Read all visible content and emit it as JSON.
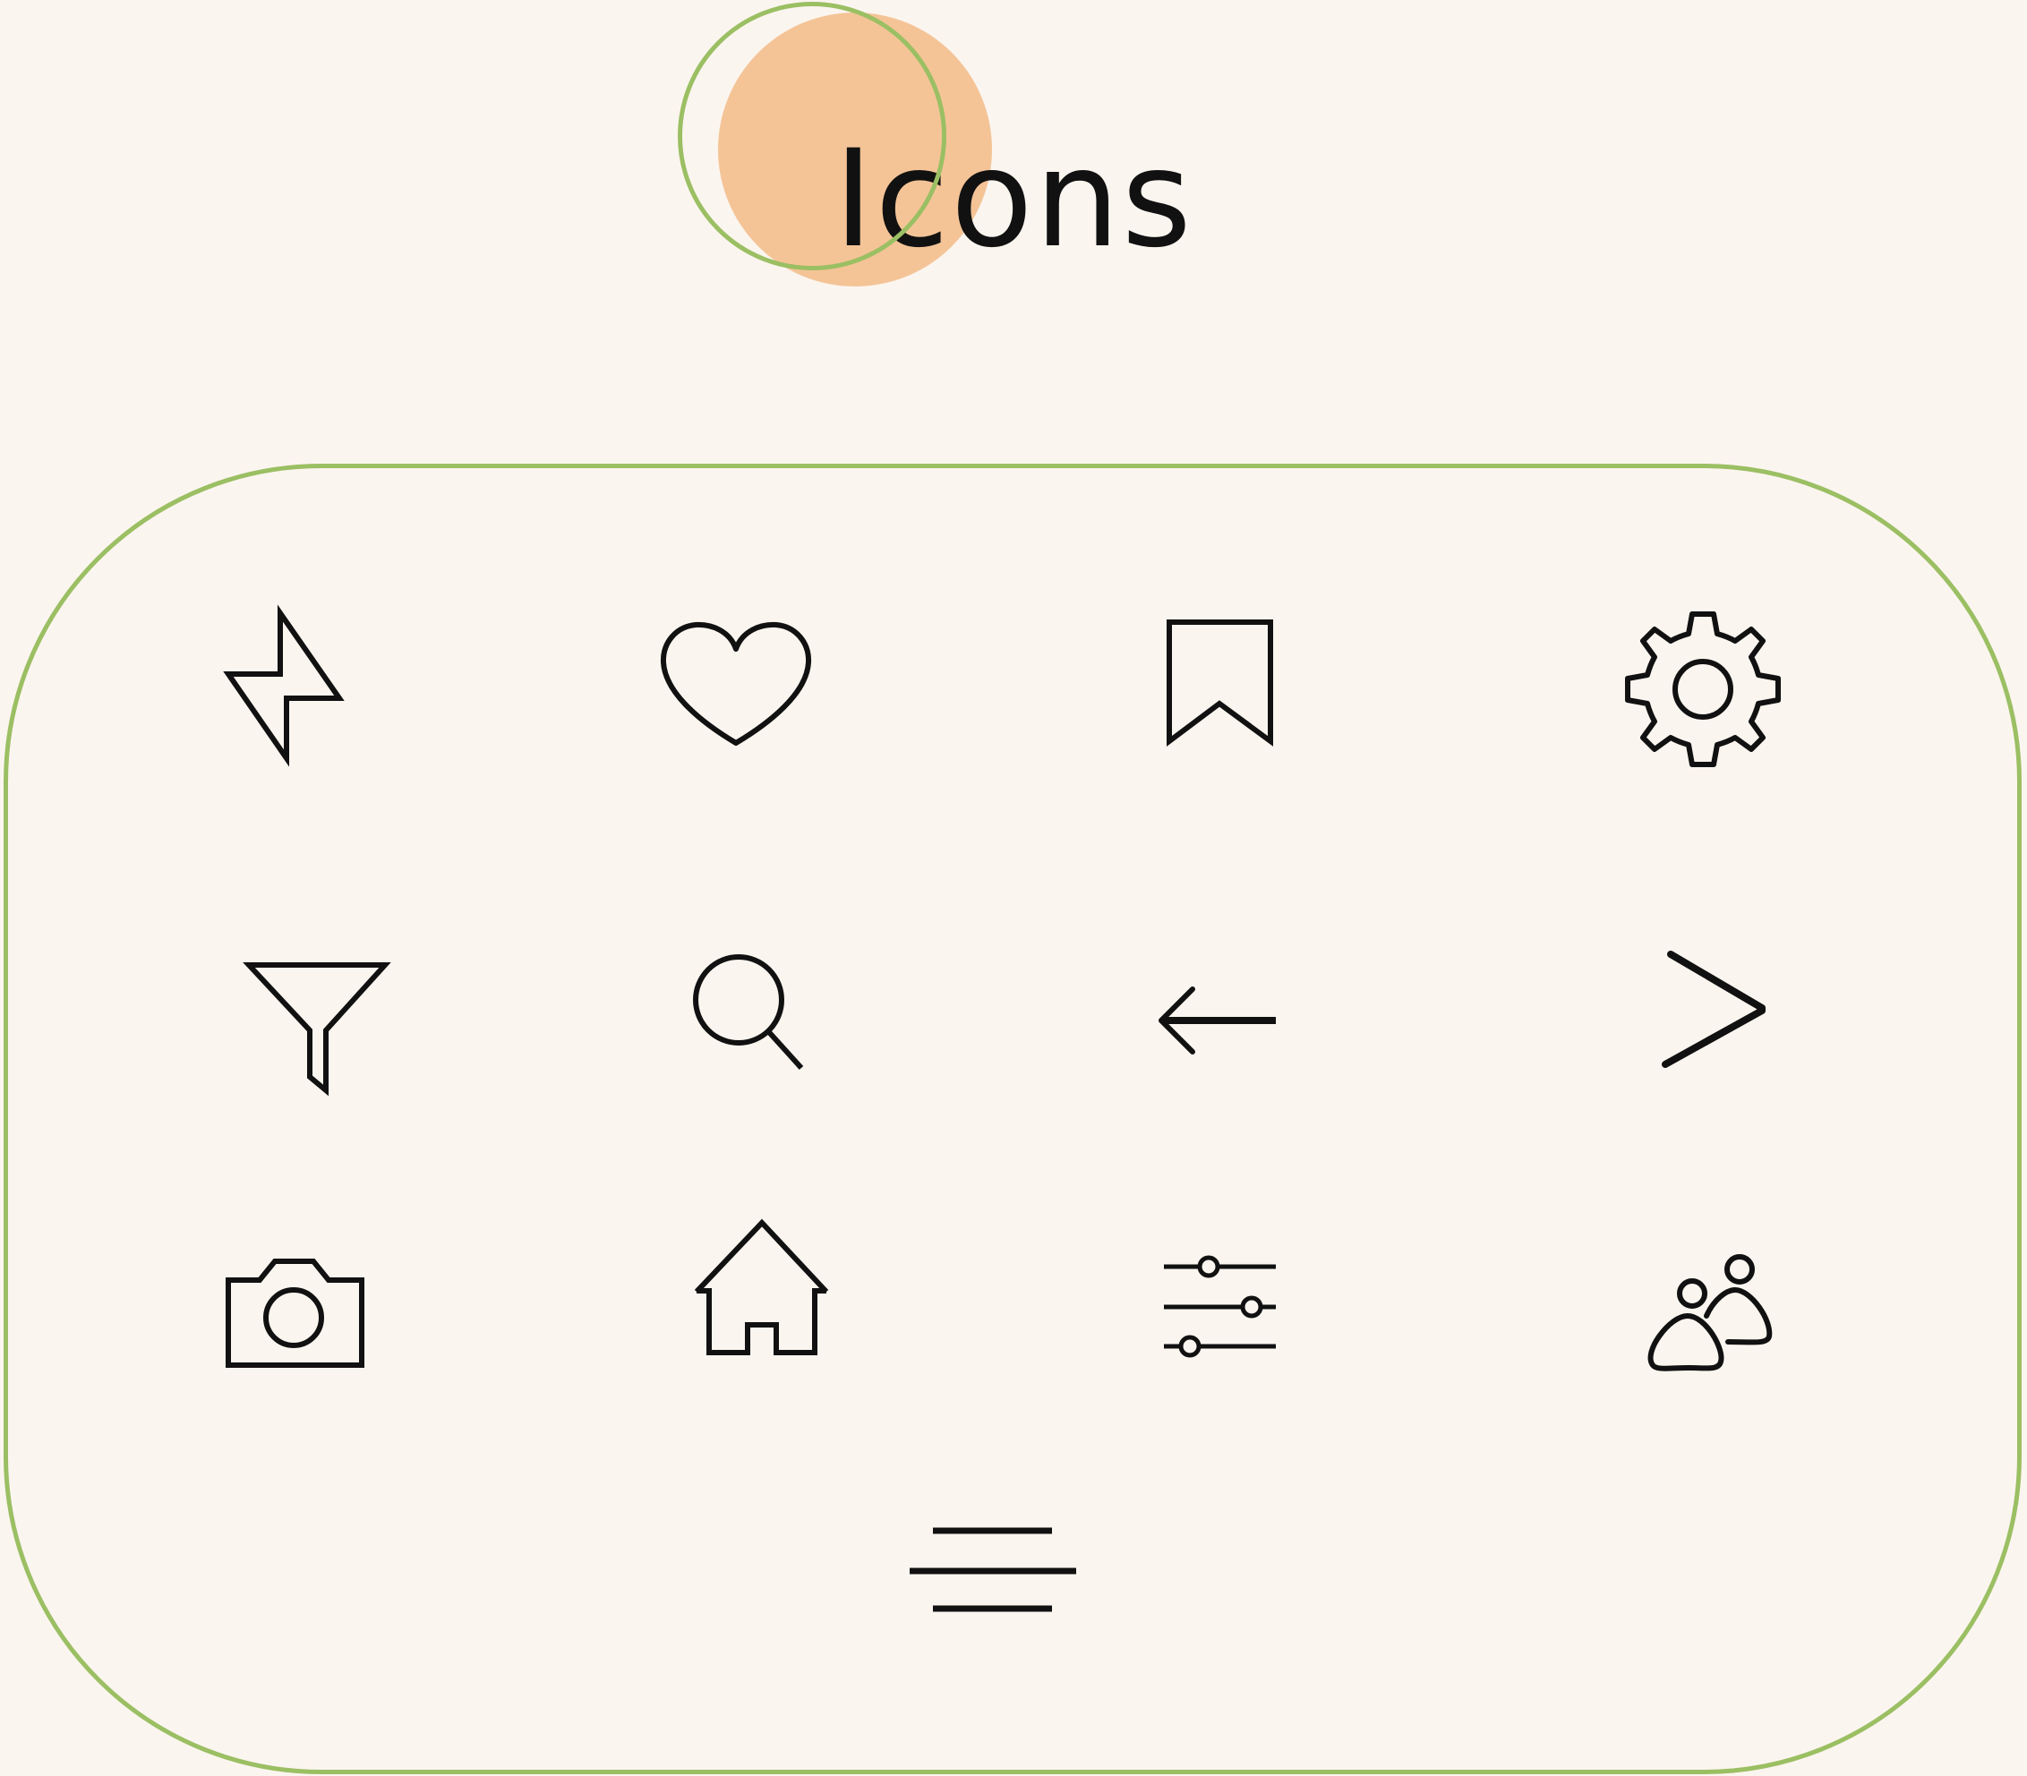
{
  "title": "Icons",
  "colors": {
    "background": "#fbf5ef",
    "accent_green": "#9bbf63",
    "accent_peach": "#f4c497",
    "icon_stroke": "#111111"
  },
  "icons": [
    {
      "name": "lightning-icon"
    },
    {
      "name": "heart-icon"
    },
    {
      "name": "bookmark-icon"
    },
    {
      "name": "gear-icon"
    },
    {
      "name": "filter-icon"
    },
    {
      "name": "search-icon"
    },
    {
      "name": "arrow-left-icon"
    },
    {
      "name": "chevron-right-icon"
    },
    {
      "name": "camera-icon"
    },
    {
      "name": "home-icon"
    },
    {
      "name": "sliders-icon"
    },
    {
      "name": "users-icon"
    },
    {
      "name": "menu-icon"
    }
  ]
}
